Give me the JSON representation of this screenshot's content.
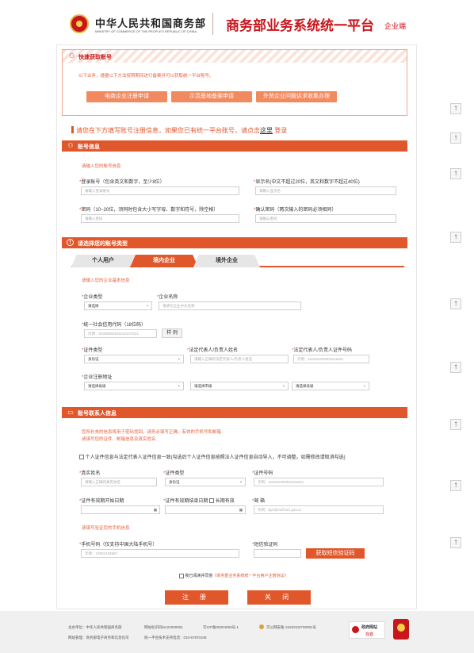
{
  "header": {
    "ministry_cn": "中华人民共和国商务部",
    "ministry_en": "MINISTRY OF COMMERCE OF THE PEOPLE'S REPUBLIC OF CHINA",
    "platform": "商务部业务系统统一平台",
    "platform_sub": "企业端"
  },
  "quick": {
    "title": "快速获取账号",
    "desc": "以下业务，遵循以下方法按照期间进行备案并可以获取统一平台账号。",
    "buttons": [
      "电商企业注册申请",
      "示范基地备案申请",
      "外贸企业问题诉求收集办理"
    ]
  },
  "login_hint": {
    "prefix": "请您在下方填写账号注册信息，如果您已有统一平台账号，请点击",
    "link": "这里",
    "suffix": "登录"
  },
  "account": {
    "title": "账号信息",
    "hint": "请输入您的账号信息",
    "login_label": "登录账号（包含英文和数字，至少8位）",
    "login_ph": "请输入登录账号",
    "display_label": "显示名(中文不超过20位，英文和数字不超过40位)",
    "display_ph": "请输入显示名",
    "pwd_label": "密码（10~20位，须同时包含大小写字母、数字和符号，除空格）",
    "pwd_ph": "请输入密码",
    "confirm_label": "确认密码（两次输入的密码必须相同）",
    "confirm_ph": "请确认密码"
  },
  "type": {
    "title": "请选择您的账号类型",
    "tabs": [
      "个人用户",
      "境内企业",
      "境外企业"
    ],
    "hint": "请输入您的企业基本信息",
    "ent_type_label": "企业类型",
    "ent_type_value": "请选择",
    "ent_name_label": "企业名称",
    "ent_name_ph": "请填写企业中文名称",
    "credit_label": "统一社会信用代码（18位码）",
    "credit_ph": "示例：91000000101010107013",
    "credit_btn": "样 例",
    "cert_type_label": "证件类型",
    "cert_type_value": "身份证",
    "legal_name_label": "法定代表人/负责人姓名",
    "legal_name_ph": "请输入正确的法定代表人/负责人姓名",
    "legal_no_label": "法定代表人/负责人证件号码",
    "legal_no_ph": "示例：110101200001011524",
    "addr_label": "企业注册地址",
    "addr_province": "请选择省级",
    "addr_city": "请选择市级",
    "addr_county": "请选择县级"
  },
  "contact": {
    "title": "账号联系人信息",
    "hint1": "您所补充的信息将用于密码找回，请务必填写正确、有效的手机号和邮箱",
    "hint2": "请填写您的证件、邮箱信息及真实姓名",
    "same_check": "个人证件信息与法定代表人证件信息一致(勾选后个人证件信息按照法人证件信息自动导入，不可调整。如需修改请取消勾选)",
    "name_label": "真实姓名",
    "name_ph": "请输入正确的真实姓名",
    "cert_type_label": "证件类型",
    "cert_type_value": "身份证",
    "cert_no_label": "证件号码",
    "cert_no_ph": "示例：110101200001011524",
    "start_label": "证件有效期开始日期",
    "end_label": "证件有效期结束日期",
    "long_term": "长期有效",
    "email_label": "邮 箱",
    "email_ph": "示例：bjzt@mofcom.gov.cn",
    "phone_hint": "请填写验证您的手机信息",
    "mobile_label": "手机号码（仅支持中国大陆手机号）",
    "mobile_ph": "示例：13901234567",
    "sms_label": "短信验证码",
    "sms_btn": "获取短信验证码",
    "agree_prefix": "我已阅读并同意",
    "agree_link": "《商务部业务系统统一平台用户注册协议》"
  },
  "actions": {
    "register": "注 册",
    "close": "关 闭"
  },
  "side_top_icon": "↑",
  "footer": {
    "host": "主办单位：中华人民共和国商务部",
    "site_code": "网站标识码bm22000001",
    "icp": "京ICP备05004093号-1",
    "police": "京公网安备 11040102700091号",
    "maintain": "网站管理：商务部电子商务和信息化司",
    "support": "统一平台技术支持电话：010-67870108",
    "badge": "政府网站",
    "badge_sub": "找错"
  },
  "colors": {
    "primary": "#e1572c",
    "brand_red": "#c8161d"
  }
}
